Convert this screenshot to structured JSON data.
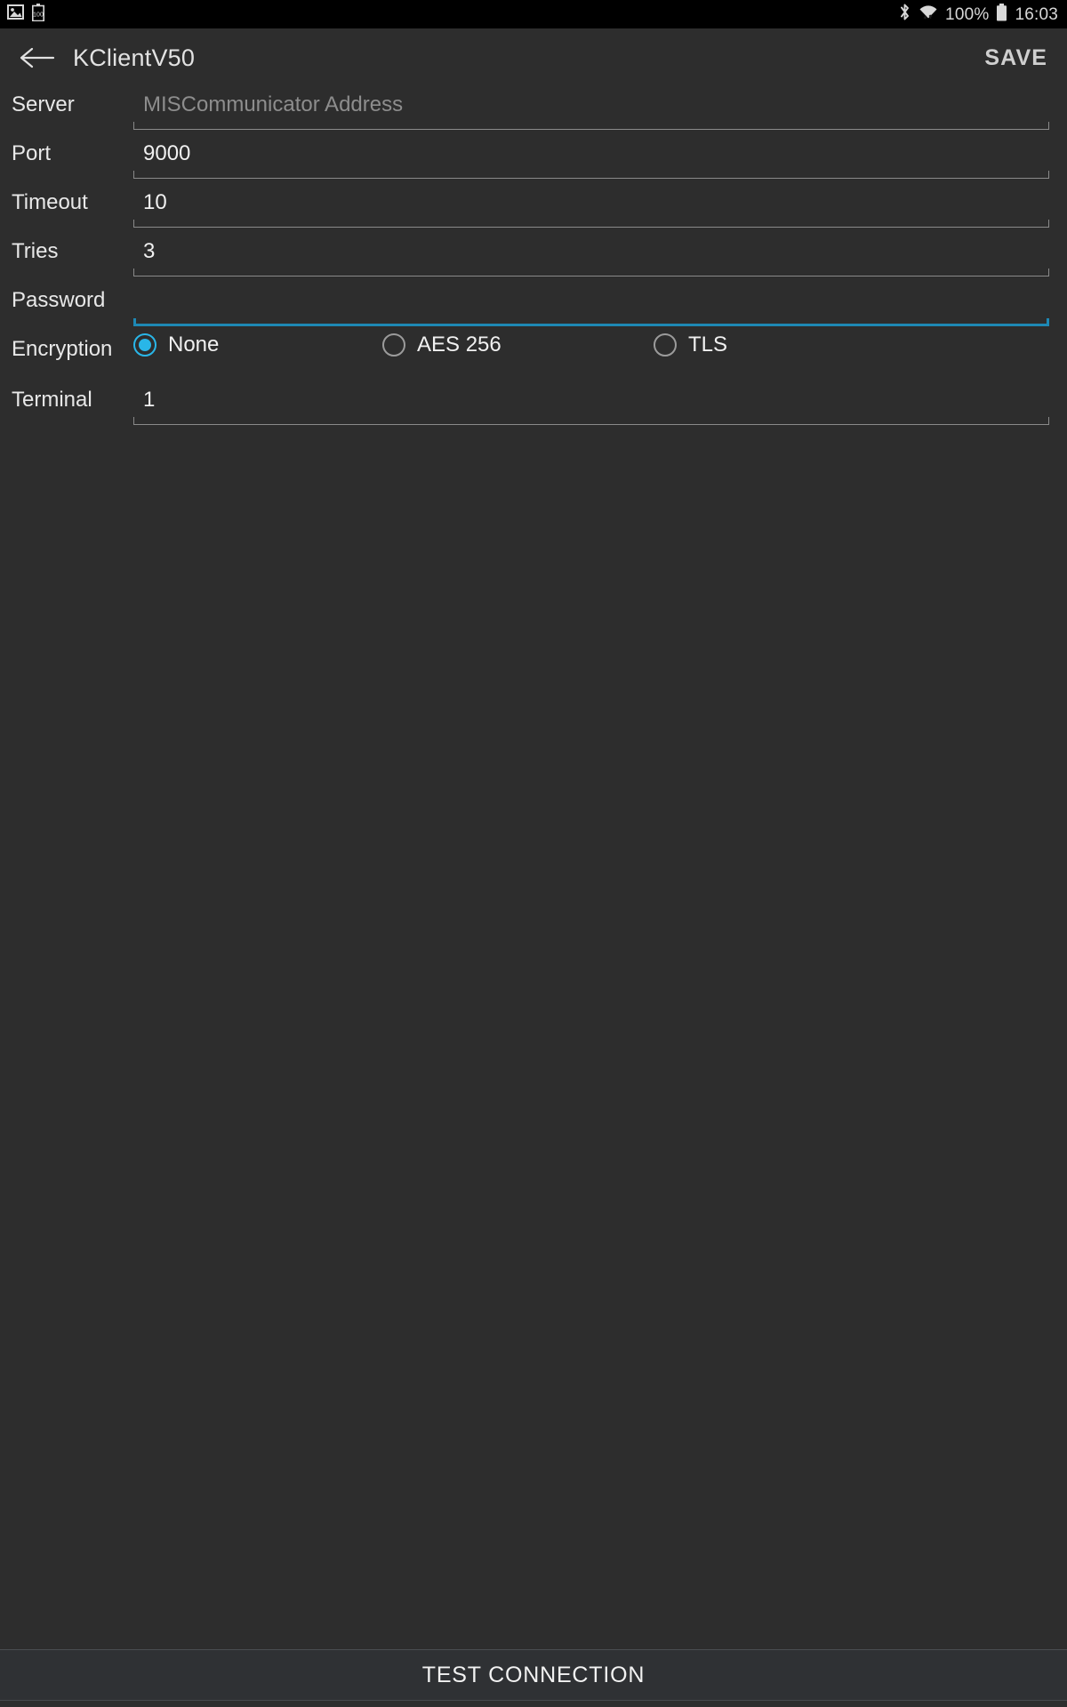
{
  "status_bar": {
    "left_icons": [
      {
        "name": "screenshot-image-icon",
        "glyph": "image"
      },
      {
        "name": "battery-saver-100-icon",
        "glyph": "battery-100"
      }
    ],
    "right_icons": [
      {
        "name": "bluetooth-icon",
        "glyph": "bluetooth"
      },
      {
        "name": "wifi-icon",
        "glyph": "wifi"
      }
    ],
    "battery_percent": "100%",
    "time": "16:03"
  },
  "app_bar": {
    "back_label": "back",
    "title": "KClientV50",
    "save_label": "SAVE"
  },
  "form": {
    "rows": [
      {
        "label": "Server",
        "value": "",
        "placeholder": "MISCommunicator Address",
        "focused": false
      },
      {
        "label": "Port",
        "value": "9000",
        "placeholder": "",
        "focused": false
      },
      {
        "label": "Timeout",
        "value": "10",
        "placeholder": "",
        "focused": false
      },
      {
        "label": "Tries",
        "value": "3",
        "placeholder": "",
        "focused": false
      },
      {
        "label": "Password",
        "value": "",
        "placeholder": "",
        "focused": true
      }
    ],
    "encryption": {
      "label": "Encryption",
      "options": [
        {
          "label": "None",
          "selected": true
        },
        {
          "label": "AES 256",
          "selected": false
        },
        {
          "label": "TLS",
          "selected": false
        }
      ]
    },
    "terminal": {
      "label": "Terminal",
      "value": "1",
      "placeholder": "",
      "focused": false
    }
  },
  "bottom": {
    "test_connection_label": "TEST CONNECTION"
  },
  "colors": {
    "background": "#2d2d2d",
    "status_bar_bg": "#000000",
    "accent": "#29b6e8",
    "focus_underline": "#1e88b4",
    "underline": "#8a8a8a",
    "text_primary": "#f0f0f0",
    "text_hint": "#8d8d8d",
    "bottom_bar_bg": "#2f3134"
  }
}
